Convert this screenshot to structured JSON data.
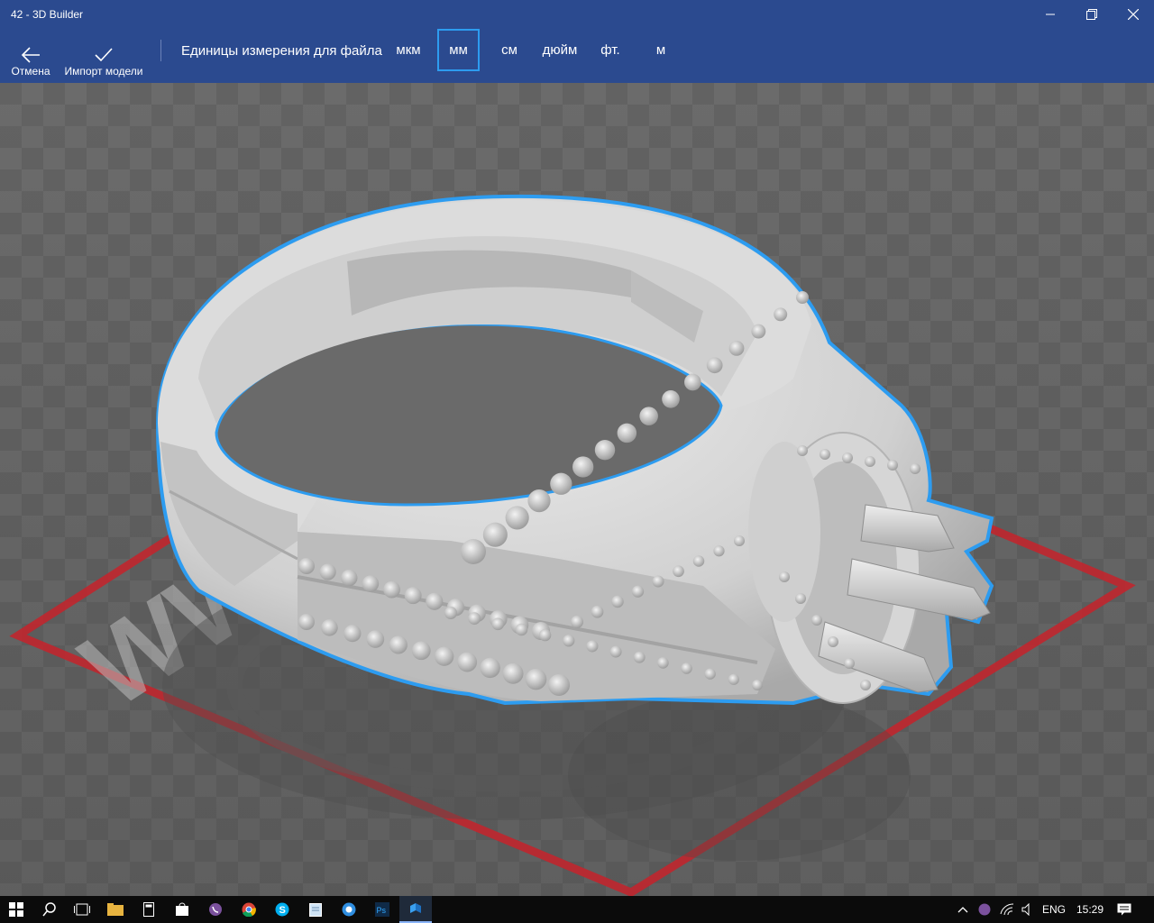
{
  "window": {
    "title": "42 - 3D Builder"
  },
  "toolbar": {
    "cancel_label": "Отмена",
    "import_label": "Импорт модели",
    "units_label": "Единицы измерения для файла",
    "units": [
      "мкм",
      "мм",
      "см",
      "дюйм",
      "фт.",
      "м"
    ],
    "selected_unit": "мм"
  },
  "viewport": {
    "watermark_text": "WW"
  },
  "taskbar": {
    "language": "ENG",
    "time": "15:29"
  },
  "colors": {
    "accent_bar": "#2b4a8f",
    "selection_outline": "#2d9cf0",
    "build_plate": "#c0262d",
    "model": "#d9d9d9"
  }
}
